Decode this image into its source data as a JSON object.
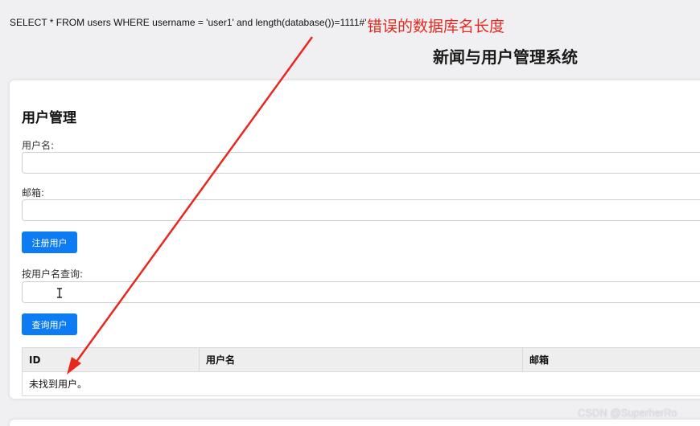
{
  "sql_query": "SELECT * FROM users WHERE username = 'user1' and length(database())=1111#'",
  "annotation": "错误的数据库名长度",
  "app_title": "新闻与用户管理系统",
  "user_management": {
    "title": "用户管理",
    "username_label": "用户名:",
    "username_value": "",
    "email_label": "邮箱:",
    "email_value": "",
    "register_button": "注册用户",
    "search_label": "按用户名查询:",
    "search_value": "",
    "search_button": "查询用户"
  },
  "table": {
    "headers": [
      "ID",
      "用户名",
      "邮箱"
    ],
    "empty_message": "未找到用户。"
  },
  "colors": {
    "accent": "#0d7cf2",
    "annotation": "#e8281e"
  },
  "watermark": "CSDN @SuperherRo"
}
